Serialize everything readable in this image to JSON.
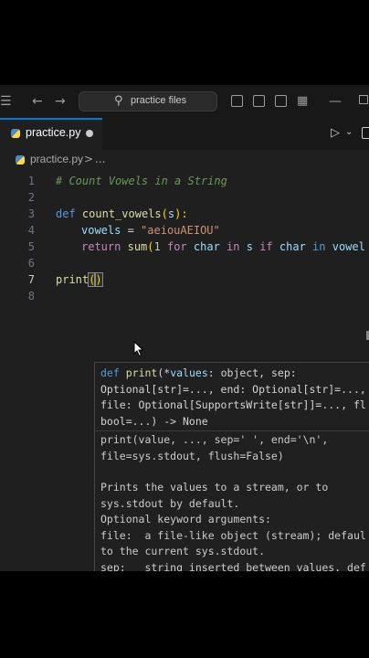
{
  "titlebar": {
    "search_label": "practice files"
  },
  "tab": {
    "label": "practice.py"
  },
  "breadcrumb": {
    "file": "practice.py",
    "separator": ">",
    "more": "..."
  },
  "editor": {
    "line_numbers": [
      "1",
      "2",
      "3",
      "4",
      "5",
      "6",
      "7",
      "8"
    ],
    "lines": {
      "l1": "# Count Vowels in a String",
      "l3_def": "def",
      "l3_fn": "count_vowels",
      "l3_open": "(",
      "l3_param": "s",
      "l3_close": "):",
      "l4_var": "vowels",
      "l4_eq": " = ",
      "l4_str": "\"aeiouAEIOU\"",
      "l5_return": "return",
      "l5_sum": "sum",
      "l5_open": "(",
      "l5_one": "1",
      "l5_for": "for",
      "l5_char": "char",
      "l5_in": "in",
      "l5_s": "s",
      "l5_if": "if",
      "l5_char2": "char",
      "l5_in2": "in",
      "l5_vowel": "vowel",
      "l7_print": "print",
      "l7_open": "(",
      "l7_close": ")"
    }
  },
  "hover": {
    "sig1_def": "def",
    "sig1_print": "print",
    "sig1_rest": "(*",
    "sig1_values": "values",
    "sig1_obj": ": object, sep:",
    "sig2": "Optional[str]=..., end: Optional[str]=...,",
    "sig3": "file: Optional[SupportsWrite[str]]=..., fl",
    "sig4": "bool=...) -> None",
    "desc1": "print(value, ..., sep=' ', end='\\n',",
    "desc2": "file=sys.stdout, flush=False)",
    "doc1": "Prints the values to a stream, or to",
    "doc2": "sys.stdout by default.",
    "doc3": "Optional keyword arguments:",
    "doc4": "file:  a file-like object (stream); defaul",
    "doc5": "to the current sys.stdout.",
    "doc6": "sep:   string inserted between values, def"
  },
  "colors": {
    "accent": "#0078d4",
    "editor_bg": "#1f1f1f",
    "comment": "#6a9955",
    "keyword": "#569cd6",
    "function": "#dcdcaa",
    "string": "#ce9178",
    "control": "#c586c0"
  },
  "icons": [
    "menu-icon",
    "back-arrow-icon",
    "forward-arrow-icon",
    "search-icon",
    "toggle-sidebar-icon",
    "toggle-panel-icon",
    "toggle-secondary-sidebar-icon",
    "customize-layout-icon",
    "minimize-icon",
    "maximize-icon",
    "python-file-icon",
    "run-icon",
    "split-editor-icon",
    "mouse-pointer-icon"
  ]
}
